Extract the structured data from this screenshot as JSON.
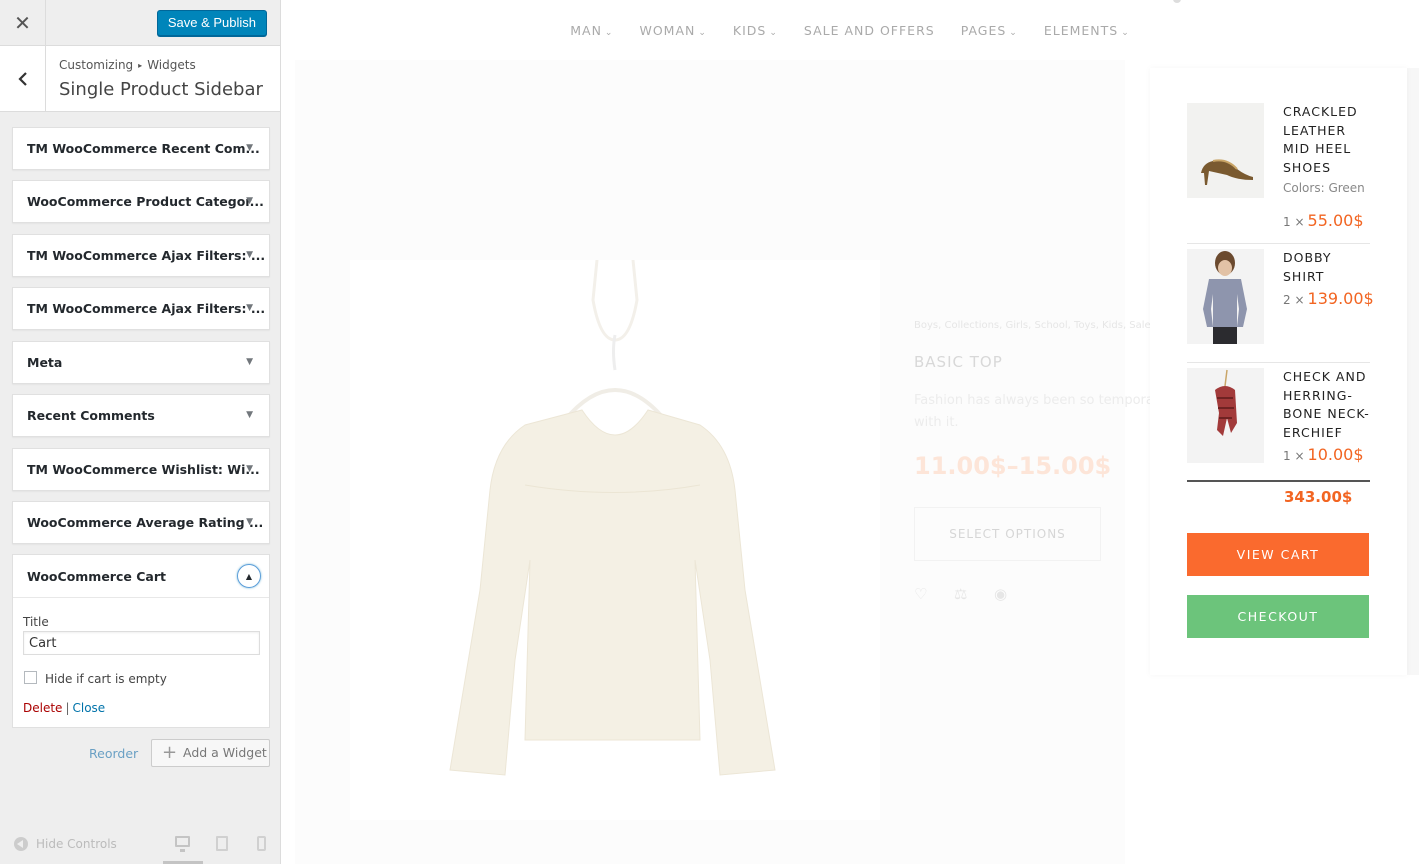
{
  "customizer": {
    "close_icon": "close-icon",
    "save_label": "Save & Publish",
    "breadcrumb": {
      "parent": "Customizing",
      "current": "Widgets"
    },
    "section_title": "Single Product Sidebar",
    "widgets": [
      {
        "label": "TM WooCommerce Recent Com..."
      },
      {
        "label": "WooCommerce Product Categor..."
      },
      {
        "label": "TM WooCommerce Ajax Filters: ..."
      },
      {
        "label": "TM WooCommerce Ajax Filters: ..."
      },
      {
        "label": "Meta"
      },
      {
        "label": "Recent Comments"
      },
      {
        "label": "TM WooCommerce Wishlist: Wi..."
      },
      {
        "label": "WooCommerce Average Rating ..."
      }
    ],
    "open_widget": {
      "label": "WooCommerce Cart",
      "title_label": "Title",
      "title_value": "Cart",
      "hide_if_empty_label": "Hide if cart is empty",
      "hide_if_empty_checked": false,
      "delete_label": "Delete",
      "separator": "|",
      "close_label": "Close"
    },
    "reorder_label": "Reorder",
    "add_widget_label": "Add a Widget",
    "hide_controls_label": "Hide Controls",
    "preview_device": "desktop"
  },
  "preview": {
    "nav": [
      {
        "label": "MAN",
        "dropdown": true
      },
      {
        "label": "WOMAN",
        "dropdown": true
      },
      {
        "label": "KIDS",
        "dropdown": true
      },
      {
        "label": "SALE AND OFFERS",
        "dropdown": false
      },
      {
        "label": "PAGES",
        "dropdown": true
      },
      {
        "label": "ELEMENTS",
        "dropdown": true
      }
    ],
    "product": {
      "categories": "Boys, Collections, Girls, School, Toys, Kids, Sale...",
      "name": "BASIC TOP",
      "description": "Fashion has always been so temporary with it.",
      "price": "11.00$–15.00$",
      "select_label": "SELECT OPTIONS"
    },
    "mini_cart": {
      "items": [
        {
          "name": "CRACKLED LEATHER MID HEEL SHOES",
          "attribute": "Colors: Green",
          "qty": "1",
          "times": "×",
          "price": "55.00$"
        },
        {
          "name": "DOBBY SHIRT",
          "attribute": "",
          "qty": "2",
          "times": "×",
          "price": "139.00$"
        },
        {
          "name": "CHECK AND HERRING-BONE NECK-ERCHIEF",
          "attribute": "",
          "qty": "1",
          "times": "×",
          "price": "10.00$"
        }
      ],
      "total": "343.00$",
      "view_cart_label": "VIEW CART",
      "checkout_label": "CHECKOUT"
    },
    "colors": {
      "accent": "#f26522",
      "view_cart": "#fa6a2e",
      "checkout": "#6cc47b",
      "publish": "#0085ba"
    }
  }
}
